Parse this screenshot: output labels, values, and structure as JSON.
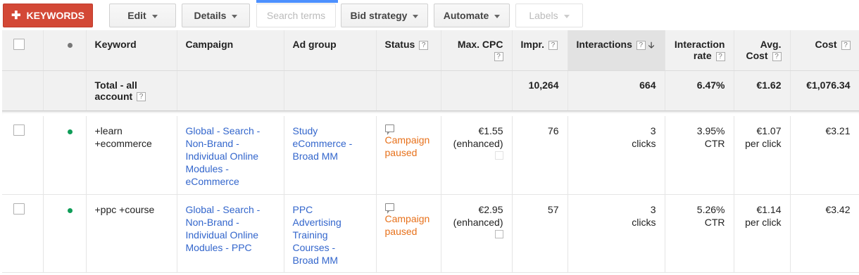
{
  "toolbar": {
    "keywords_label": "KEYWORDS",
    "edit_label": "Edit",
    "details_label": "Details",
    "search_terms_label": "Search terms",
    "bid_strategy_label": "Bid strategy",
    "automate_label": "Automate",
    "labels_label": "Labels"
  },
  "columns": {
    "keyword": "Keyword",
    "campaign": "Campaign",
    "ad_group": "Ad group",
    "status": "Status",
    "max_cpc": "Max. CPC",
    "impr": "Impr.",
    "interactions": "Interactions",
    "interaction_rate_1": "Interaction",
    "interaction_rate_2": "rate",
    "avg_cost_1": "Avg.",
    "avg_cost_2": "Cost",
    "cost": "Cost",
    "help": "?"
  },
  "total": {
    "label_1": "Total - all",
    "label_2": "account",
    "impr": "10,264",
    "interactions": "664",
    "interaction_rate": "6.47%",
    "avg_cost": "€1.62",
    "cost": "€1,076.34"
  },
  "rows": [
    {
      "keyword_1": "+learn",
      "keyword_2": "+ecommerce",
      "campaign": [
        "Global - Search -",
        "Non-Brand -",
        "Individual Online",
        "Modules -",
        "eCommerce"
      ],
      "ad_group": [
        "Study",
        "eCommerce -",
        "Broad MM"
      ],
      "status_1": "Campaign",
      "status_2": "paused",
      "max_cpc": "€1.55",
      "max_cpc_note": "(enhanced)",
      "impr": "76",
      "interactions_value": "3",
      "interactions_unit": "clicks",
      "rate_value": "3.95%",
      "rate_unit": "CTR",
      "avg_cost_value": "€1.07",
      "avg_cost_unit": "per click",
      "cost": "€3.21"
    },
    {
      "keyword_1": "+ppc +course",
      "keyword_2": "",
      "campaign": [
        "Global - Search -",
        "Non-Brand -",
        "Individual Online",
        "Modules - PPC",
        ""
      ],
      "ad_group": [
        "PPC",
        "Advertising",
        "Training",
        "Courses -",
        "Broad MM"
      ],
      "status_1": "Campaign",
      "status_2": "paused",
      "max_cpc": "€2.95",
      "max_cpc_note": "(enhanced)",
      "impr": "57",
      "interactions_value": "3",
      "interactions_unit": "clicks",
      "rate_value": "5.26%",
      "rate_unit": "CTR",
      "avg_cost_value": "€1.14",
      "avg_cost_unit": "per click",
      "cost": "€3.42"
    }
  ],
  "colors": {
    "accent": "#d34836",
    "link": "#3366cc",
    "paused": "#e7711b",
    "enabled_dot": "#0f9d58"
  }
}
